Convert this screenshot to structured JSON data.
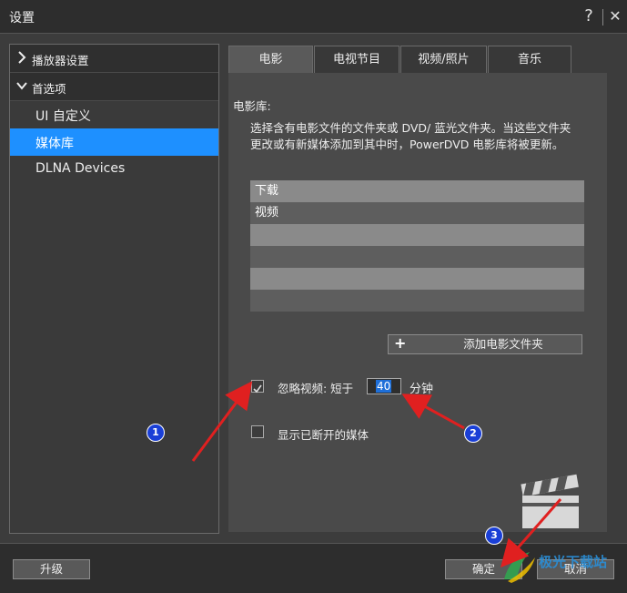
{
  "window": {
    "title": "设置",
    "help_glyph": "?",
    "close_glyph": "✕"
  },
  "nav": {
    "groups": [
      {
        "label": "播放器设置",
        "icon": "chevron-right-icon"
      },
      {
        "label": "首选项",
        "icon": "chevron-down-icon"
      }
    ],
    "items": [
      {
        "label": "UI 自定义"
      },
      {
        "label": "媒体库",
        "selected": true
      },
      {
        "label": "DLNA Devices"
      }
    ]
  },
  "tabs": [
    {
      "label": "电影",
      "active": true
    },
    {
      "label": "电视节目"
    },
    {
      "label": "视频/照片"
    },
    {
      "label": "音乐"
    }
  ],
  "movie_library": {
    "section_title": "电影库:",
    "description": "选择含有电影文件的文件夹或 DVD/ 蓝光文件夹。当这些文件夹更改或有新媒体添加到其中时，PowerDVD 电影库将被更新。",
    "folders": [
      "下载",
      "视频",
      "",
      "",
      "",
      ""
    ],
    "add_folder_button": "添加电影文件夹",
    "ignore_video_label": "忽略视频: 短于",
    "ignore_video_checked": true,
    "ignore_minutes_value": "40",
    "minutes_unit": "分钟",
    "show_disconnected_label": "显示已断开的媒体",
    "show_disconnected_checked": false
  },
  "footer": {
    "upgrade_button": "升级",
    "ok_button": "确定",
    "cancel_button": "取消"
  },
  "annotations": {
    "badge_1": "1",
    "badge_2": "2",
    "badge_3": "3"
  },
  "watermark": "极光下载站",
  "colors": {
    "accent": "#1e90ff",
    "arrow": "#e02020",
    "badge": "#1a3fd6"
  }
}
